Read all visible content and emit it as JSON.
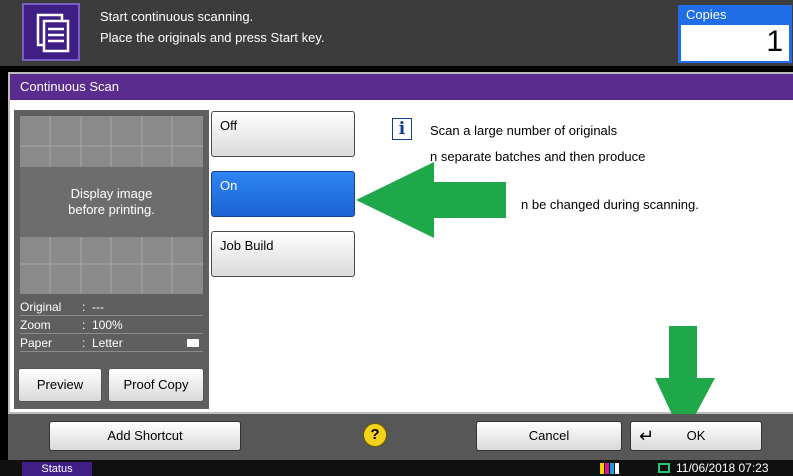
{
  "header": {
    "line1": "Start continuous scanning.",
    "line2": "Place the originals and press Start key.",
    "copies_label": "Copies",
    "copies_value": "1"
  },
  "panel": {
    "title": "Continuous Scan",
    "preview": {
      "message_line1": "Display image",
      "message_line2": "before printing.",
      "original_label": "Original",
      "original_value": "---",
      "zoom_label": "Zoom",
      "zoom_value": "100%",
      "paper_label": "Paper",
      "paper_value": "Letter",
      "separator": ":",
      "preview_button": "Preview",
      "proof_copy_button": "Proof Copy"
    },
    "options": [
      {
        "label": "Off",
        "selected": false
      },
      {
        "label": "On",
        "selected": true
      },
      {
        "label": "Job Build",
        "selected": false
      }
    ],
    "description": {
      "line1": "Scan a large number of originals",
      "line2": "n separate batches and then produce",
      "line3": "n be changed during scanning."
    }
  },
  "bottom": {
    "add_shortcut": "Add Shortcut",
    "help": "?",
    "cancel": "Cancel",
    "ok": "OK",
    "enter_symbol": "↵"
  },
  "status_bar": {
    "status": "Status",
    "datetime": "11/06/2018  07:23"
  },
  "colors": {
    "accent_purple": "#5a2c8f",
    "selected_blue": "#1f6ee8",
    "arrow_green": "#1fa84a",
    "help_yellow": "#f2d21b"
  },
  "icons": {
    "header": "document-scan-icon",
    "info": "info-icon",
    "help": "help-icon",
    "paper": "paper-icon",
    "enter": "enter-icon"
  }
}
